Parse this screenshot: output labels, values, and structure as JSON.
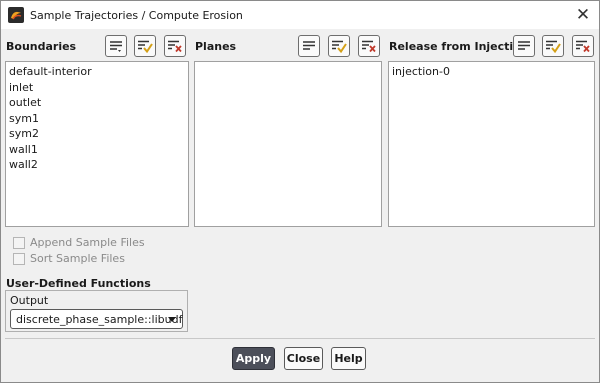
{
  "window": {
    "title": "Sample Trajectories / Compute Erosion"
  },
  "boundaries": {
    "label": "Boundaries",
    "items": [
      "default-interior",
      "inlet",
      "outlet",
      "sym1",
      "sym2",
      "wall1",
      "wall2"
    ]
  },
  "planes": {
    "label": "Planes",
    "items": []
  },
  "injections": {
    "label": "Release from Injections",
    "items": [
      "injection-0"
    ]
  },
  "options": {
    "append_label": "Append Sample Files",
    "sort_label": "Sort Sample Files"
  },
  "udf": {
    "section_label": "User-Defined Functions",
    "output_label": "Output",
    "output_value": "discrete_phase_sample::libudf"
  },
  "footer": {
    "apply": "Apply",
    "close": "Close",
    "help": "Help"
  },
  "colors": {
    "check_accent": "#d4a017",
    "clear_accent": "#c0392b",
    "primary_button": "#4c4f5a"
  }
}
